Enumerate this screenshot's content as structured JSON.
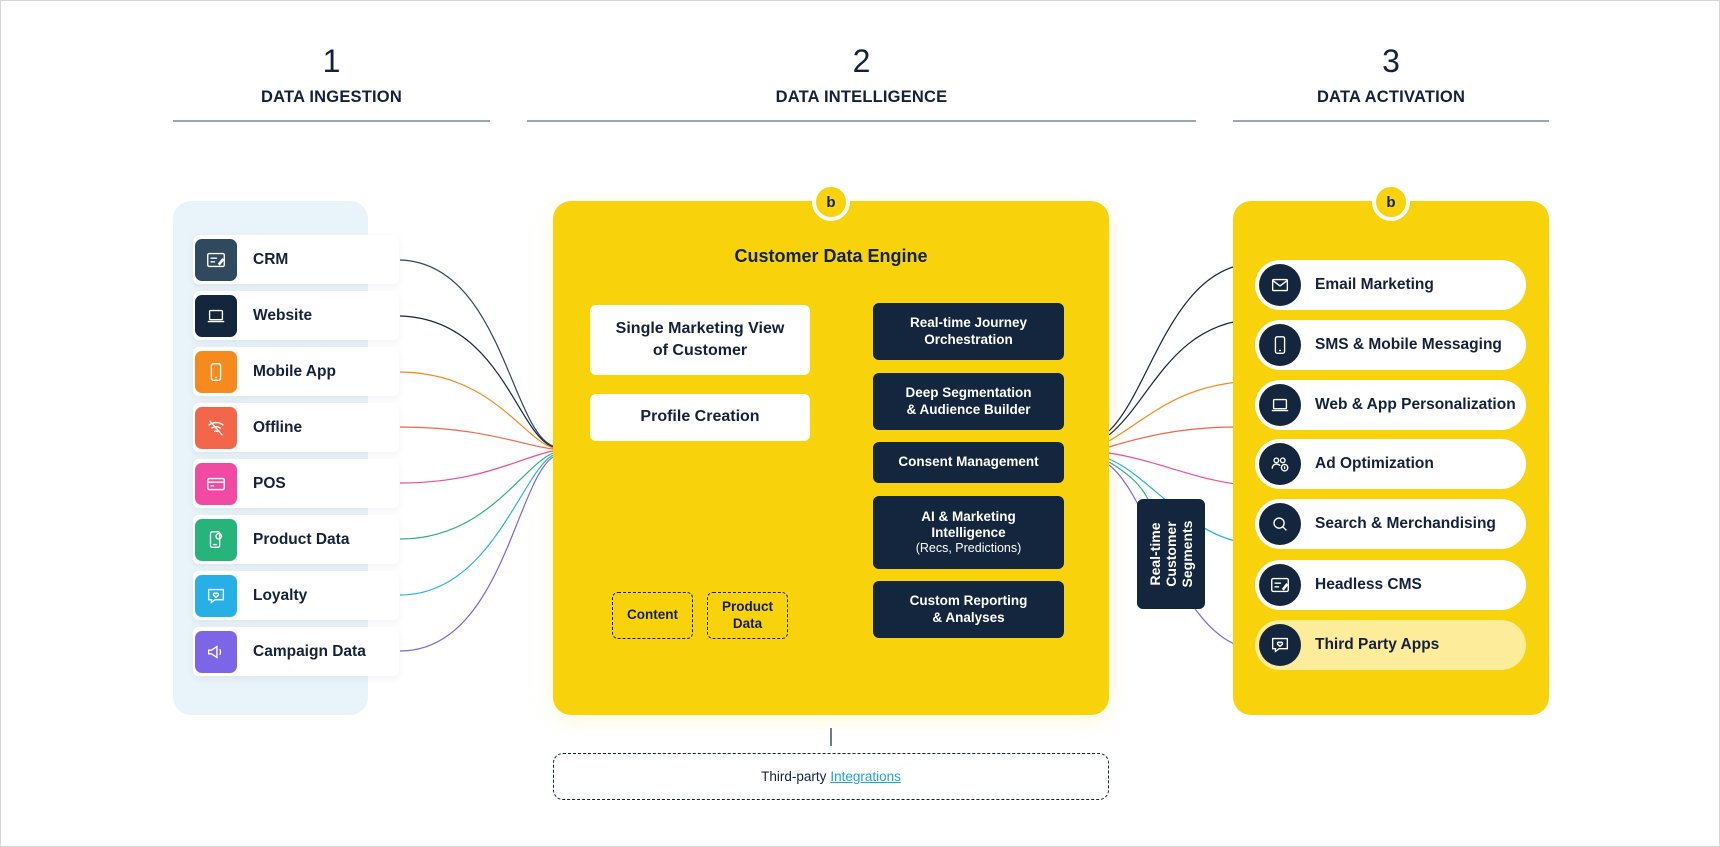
{
  "columns": [
    {
      "number": "1",
      "title": "DATA INGESTION"
    },
    {
      "number": "2",
      "title": "DATA INTELLIGENCE"
    },
    {
      "number": "3",
      "title": "DATA ACTIVATION"
    }
  ],
  "colors": {
    "navy": "#14263d",
    "yellow": "#f8d20b",
    "panel_light": "#e8f4f9",
    "link": "#1aa7d8"
  },
  "sources": [
    {
      "label": "CRM",
      "icon": "crm-form-icon",
      "color": "#2f4a5e"
    },
    {
      "label": "Website",
      "icon": "laptop-icon",
      "color": "#14263d"
    },
    {
      "label": "Mobile App",
      "icon": "mobile-phone-icon",
      "color": "#f78a1d"
    },
    {
      "label": "Offline",
      "icon": "wifi-off-icon",
      "color": "#f4664a"
    },
    {
      "label": "POS",
      "icon": "card-icon",
      "color": "#f04aa3"
    },
    {
      "label": "Product Data",
      "icon": "product-tag-icon",
      "color": "#27b47a"
    },
    {
      "label": "Loyalty",
      "icon": "heart-chat-icon",
      "color": "#27b0e6"
    },
    {
      "label": "Campaign Data",
      "icon": "megaphone-icon",
      "color": "#7c65e6"
    }
  ],
  "engine": {
    "badge": "b",
    "title": "Customer Data Engine",
    "single_view": "Single Marketing View\nof Customer",
    "profile": "Profile Creation",
    "content": "Content",
    "product_data": "Product\nData",
    "capabilities": [
      {
        "label": "Real-time Journey\nOrchestration",
        "sub": ""
      },
      {
        "label": "Deep Segmentation\n& Audience Builder",
        "sub": ""
      },
      {
        "label": "Consent Management",
        "sub": ""
      },
      {
        "label": "AI & Marketing\nIntelligence",
        "sub": "(Recs, Predictions)"
      },
      {
        "label": "Custom Reporting\n& Analyses",
        "sub": ""
      }
    ]
  },
  "segments": "Real-time\nCustomer\nSegments",
  "activation": {
    "badge": "b",
    "items": [
      {
        "label": "Email Marketing",
        "icon": "envelope-icon"
      },
      {
        "label": "SMS & Mobile Messaging",
        "icon": "mobile-phone-icon"
      },
      {
        "label": "Web & App Personalization",
        "icon": "laptop-icon"
      },
      {
        "label": "Ad Optimization",
        "icon": "people-dollar-icon"
      },
      {
        "label": "Search & Merchandising",
        "icon": "search-icon"
      },
      {
        "label": "Headless CMS",
        "icon": "cms-form-icon"
      },
      {
        "label": "Third Party Apps",
        "icon": "heart-chat-icon"
      }
    ]
  },
  "footer": {
    "prefix": "Third-party",
    "link": "Integrations"
  }
}
